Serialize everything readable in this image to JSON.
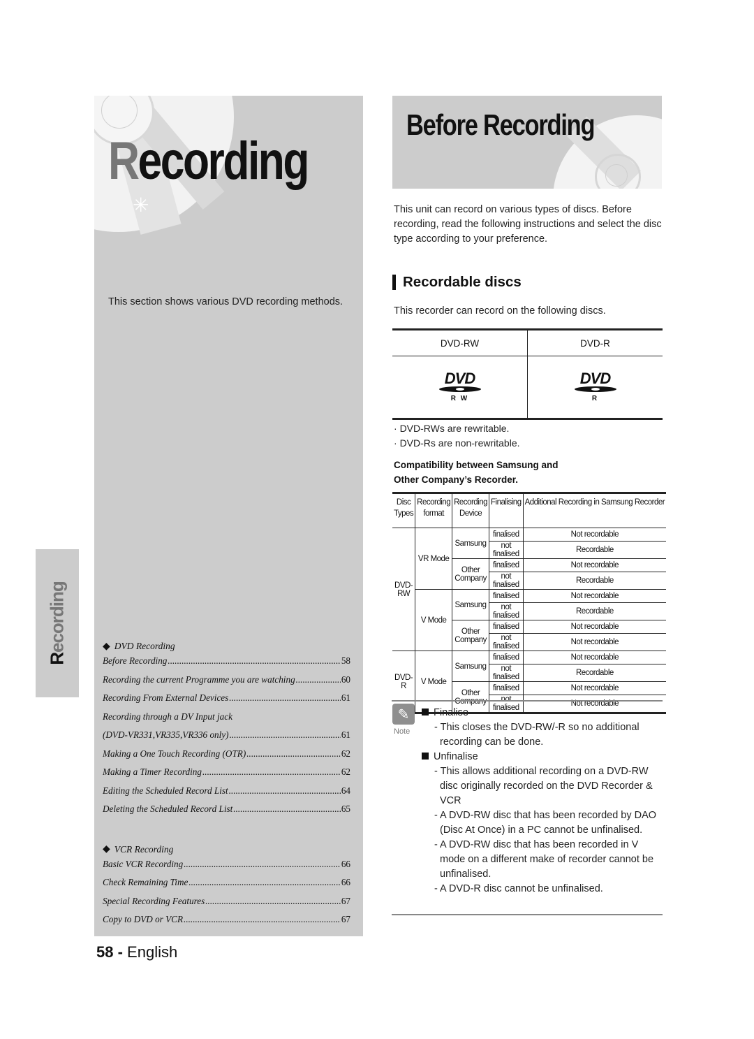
{
  "chapter": {
    "title_first_letter": "R",
    "title_rest": "ecording",
    "description": "This section shows various DVD recording methods.",
    "side_tab_first": "R",
    "side_tab_rest": "ecording"
  },
  "toc": {
    "sections": [
      {
        "heading": "DVD Recording",
        "entries": [
          {
            "title": "Before Recording",
            "page": "58"
          },
          {
            "title": "Recording the current Programme you are watching",
            "page": "60"
          },
          {
            "title": "Recording From External Devices",
            "page": "61"
          },
          {
            "title": "Recording through a DV Input jack",
            "page": ""
          },
          {
            "title": "(DVD-VR331,VR335,VR336 only)",
            "page": "61"
          },
          {
            "title": "Making a One Touch Recording (OTR)",
            "page": "62"
          },
          {
            "title": "Making a Timer Recording",
            "page": "62"
          },
          {
            "title": "Editing the Scheduled Record List",
            "page": "64"
          },
          {
            "title": "Deleting the Scheduled Record List",
            "page": "65"
          }
        ]
      },
      {
        "heading": "VCR Recording",
        "entries": [
          {
            "title": "Basic VCR Recording",
            "page": "66"
          },
          {
            "title": "Check Remaining Time",
            "page": "66"
          },
          {
            "title": "Special Recording Features",
            "page": "67"
          },
          {
            "title": "Copy to DVD or VCR",
            "page": "67"
          }
        ]
      }
    ],
    "bullet_icon": "diamond-icon"
  },
  "footer": {
    "page_number": "58 -",
    "language": "English"
  },
  "page": {
    "title": "Before Recording",
    "intro": "This unit can record on various types of discs. Before recording, read the following instructions and select the disc type according to your preference.",
    "section_heading": "Recordable discs",
    "section_lead": "This recorder can record on the following discs.",
    "disc_table": {
      "headers": [
        "DVD-RW",
        "DVD-R"
      ],
      "logo_word": "DVD",
      "logo_subs": [
        "R W",
        "R"
      ]
    },
    "bullets": [
      "DVD-RWs are rewritable.",
      "DVD-Rs are non-rewritable."
    ],
    "compat_title_line1": "Compatibility between Samsung and",
    "compat_title_line2": "Other Company’s Recorder.",
    "compat_table": {
      "headers": [
        "Disc Types",
        "Recording format",
        "Recording Device",
        "Finalising",
        "Additional Recording in Samsung Recorder"
      ],
      "rows": [
        {
          "disc": "DVD-RW",
          "format": "VR Mode",
          "device": "Samsung",
          "finalising": "finalised",
          "additional": "Not recordable"
        },
        {
          "disc": "DVD-RW",
          "format": "VR Mode",
          "device": "Samsung",
          "finalising": "not finalised",
          "additional": "Recordable"
        },
        {
          "disc": "DVD-RW",
          "format": "VR Mode",
          "device": "Other Company",
          "finalising": "finalised",
          "additional": "Not recordable"
        },
        {
          "disc": "DVD-RW",
          "format": "VR Mode",
          "device": "Other Company",
          "finalising": "not finalised",
          "additional": "Recordable"
        },
        {
          "disc": "DVD-RW",
          "format": "V Mode",
          "device": "Samsung",
          "finalising": "finalised",
          "additional": "Not recordable"
        },
        {
          "disc": "DVD-RW",
          "format": "V Mode",
          "device": "Samsung",
          "finalising": "not finalised",
          "additional": "Recordable"
        },
        {
          "disc": "DVD-RW",
          "format": "V Mode",
          "device": "Other Company",
          "finalising": "finalised",
          "additional": "Not recordable"
        },
        {
          "disc": "DVD-RW",
          "format": "V Mode",
          "device": "Other Company",
          "finalising": "not finalised",
          "additional": "Not recordable"
        },
        {
          "disc": "DVD-R",
          "format": "V Mode",
          "device": "Samsung",
          "finalising": "finalised",
          "additional": "Not recordable"
        },
        {
          "disc": "DVD-R",
          "format": "V Mode",
          "device": "Samsung",
          "finalising": "not finalised",
          "additional": "Recordable"
        },
        {
          "disc": "DVD-R",
          "format": "V Mode",
          "device": "Other Company",
          "finalising": "finalised",
          "additional": "Not recordable"
        },
        {
          "disc": "DVD-R",
          "format": "V Mode",
          "device": "Other Company",
          "finalising": "not finalised",
          "additional": "Not recordable"
        }
      ]
    },
    "note": {
      "label": "Note",
      "icon": "pencil-icon",
      "items": [
        {
          "heading": "Finalise",
          "lines": [
            "- This closes the DVD-RW/-R so no additional recording can be done."
          ]
        },
        {
          "heading": "Unfinalise",
          "lines": [
            "- This allows additional recording on a DVD-RW disc originally recorded on the DVD Recorder & VCR",
            "- A DVD-RW disc that has been recorded by DAO (Disc At Once) in a PC cannot be unfinalised.",
            "- A DVD-RW disc that has been recorded in V mode on a different make of recorder cannot be unfinalised.",
            "- A DVD-R disc cannot be unfinalised."
          ]
        }
      ]
    }
  }
}
